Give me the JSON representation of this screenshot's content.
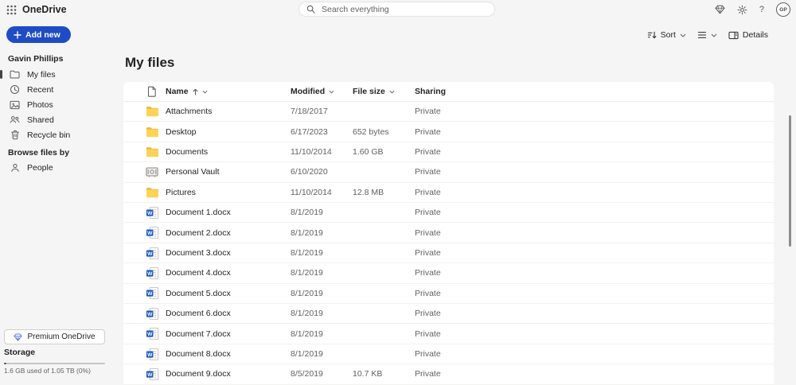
{
  "topbar": {
    "app_title": "OneDrive",
    "search_placeholder": "Search everything",
    "help_label": "?",
    "avatar_initials": "GP"
  },
  "toolbar": {
    "sort_label": "Sort",
    "details_label": "Details"
  },
  "sidebar": {
    "add_new_label": "Add new",
    "owner_name": "Gavin Phillips",
    "nav_items": [
      {
        "label": "My files",
        "icon": "folder-outline",
        "selected": true
      },
      {
        "label": "Recent",
        "icon": "clock",
        "selected": false
      },
      {
        "label": "Photos",
        "icon": "image",
        "selected": false
      },
      {
        "label": "Shared",
        "icon": "people-pair",
        "selected": false
      },
      {
        "label": "Recycle bin",
        "icon": "trash",
        "selected": false
      }
    ],
    "browse_heading": "Browse files by",
    "browse_items": [
      {
        "label": "People",
        "icon": "person",
        "selected": false
      }
    ],
    "premium_button_label": "Premium OneDrive",
    "storage_heading": "Storage",
    "storage_usage": "1.6 GB used of 1.05 TB (0%)"
  },
  "main": {
    "page_title": "My files",
    "table": {
      "columns": {
        "name": "Name",
        "modified": "Modified",
        "file_size": "File size",
        "sharing": "Sharing"
      },
      "sort": {
        "column": "Name",
        "direction": "ascending"
      },
      "rows": [
        {
          "name": "Attachments",
          "type": "folder",
          "modified": "7/18/2017",
          "size": "",
          "sharing": "Private"
        },
        {
          "name": "Desktop",
          "type": "folder",
          "modified": "6/17/2023",
          "size": "652 bytes",
          "sharing": "Private"
        },
        {
          "name": "Documents",
          "type": "folder",
          "modified": "11/10/2014",
          "size": "1.60 GB",
          "sharing": "Private"
        },
        {
          "name": "Personal Vault",
          "type": "vault",
          "modified": "6/10/2020",
          "size": "",
          "sharing": "Private"
        },
        {
          "name": "Pictures",
          "type": "folder",
          "modified": "11/10/2014",
          "size": "12.8 MB",
          "sharing": "Private"
        },
        {
          "name": "Document 1.docx",
          "type": "word",
          "modified": "8/1/2019",
          "size": "",
          "sharing": "Private"
        },
        {
          "name": "Document 2.docx",
          "type": "word",
          "modified": "8/1/2019",
          "size": "",
          "sharing": "Private"
        },
        {
          "name": "Document 3.docx",
          "type": "word",
          "modified": "8/1/2019",
          "size": "",
          "sharing": "Private"
        },
        {
          "name": "Document 4.docx",
          "type": "word",
          "modified": "8/1/2019",
          "size": "",
          "sharing": "Private"
        },
        {
          "name": "Document 5.docx",
          "type": "word",
          "modified": "8/1/2019",
          "size": "",
          "sharing": "Private"
        },
        {
          "name": "Document 6.docx",
          "type": "word",
          "modified": "8/1/2019",
          "size": "",
          "sharing": "Private"
        },
        {
          "name": "Document 7.docx",
          "type": "word",
          "modified": "8/1/2019",
          "size": "",
          "sharing": "Private"
        },
        {
          "name": "Document 8.docx",
          "type": "word",
          "modified": "8/1/2019",
          "size": "",
          "sharing": "Private"
        },
        {
          "name": "Document 9.docx",
          "type": "word",
          "modified": "8/5/2019",
          "size": "10.7 KB",
          "sharing": "Private"
        }
      ]
    }
  },
  "colors": {
    "accent_blue": "#1f4cc5",
    "word_blue": "#185abd",
    "folder_yellow": "#fdd14e",
    "text_primary": "#242424",
    "text_secondary": "#616161",
    "page_bg": "#f6f5f6",
    "panel_bg": "#ffffff"
  }
}
